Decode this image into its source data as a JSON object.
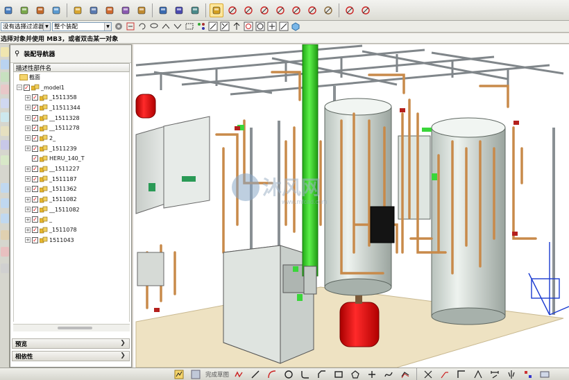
{
  "toolbar": {
    "icons": [
      "assembly-icon",
      "layers-icon",
      "table-icon",
      "grid-icon",
      "folder-icon",
      "tools-icon",
      "wrench-icon",
      "shapes-icon",
      "camera-icon",
      "stack-icon",
      "pen-icon",
      "bracket-icon",
      "pointer-icon",
      "line-icon",
      "curve-icon",
      "cross-icon",
      "arc-icon",
      "spline-icon",
      "trim-icon",
      "grid-snap-icon",
      "offset-icon",
      "circle-icon"
    ]
  },
  "filters": {
    "type_filter": "没有选择过滤器",
    "scope_filter": "整个装配"
  },
  "status_prompt": "选择对象并使用 MB3，或者双击某一对象",
  "navigator": {
    "title": "装配导航器",
    "column_header": "描述性部件名",
    "items": [
      {
        "label": "截面",
        "kind": "folder"
      },
      {
        "label": "_model1",
        "kind": "root"
      },
      {
        "label": "_1511358",
        "kind": "child"
      },
      {
        "label": "_11511344",
        "kind": "child"
      },
      {
        "label": "__1511328",
        "kind": "child"
      },
      {
        "label": "__1511278",
        "kind": "child"
      },
      {
        "label": "2_",
        "kind": "child"
      },
      {
        "label": "_1511239",
        "kind": "child"
      },
      {
        "label": "HERU_140_T",
        "kind": "leaf"
      },
      {
        "label": "__1511227",
        "kind": "child"
      },
      {
        "label": "_1511187",
        "kind": "child"
      },
      {
        "label": "_1511362",
        "kind": "child"
      },
      {
        "label": "_1511082",
        "kind": "child"
      },
      {
        "label": "__1511082",
        "kind": "child"
      },
      {
        "label": "_",
        "kind": "child"
      },
      {
        "label": "_1511078",
        "kind": "child"
      },
      {
        "label": "1511043",
        "kind": "child"
      }
    ],
    "preview_label": "预览",
    "dependency_label": "相依性"
  },
  "viewport": {
    "watermark_main": "沐风网",
    "watermark_sub": "www.mfcad.com",
    "colors": {
      "pipe": "#c88a4a",
      "green_pipe": "#33dd22",
      "tank": "#dfe6e0",
      "red_vessel": "#e01010",
      "frame": "#8c9094"
    }
  },
  "bottom": {
    "finish_sketch_label": "完成草图"
  }
}
